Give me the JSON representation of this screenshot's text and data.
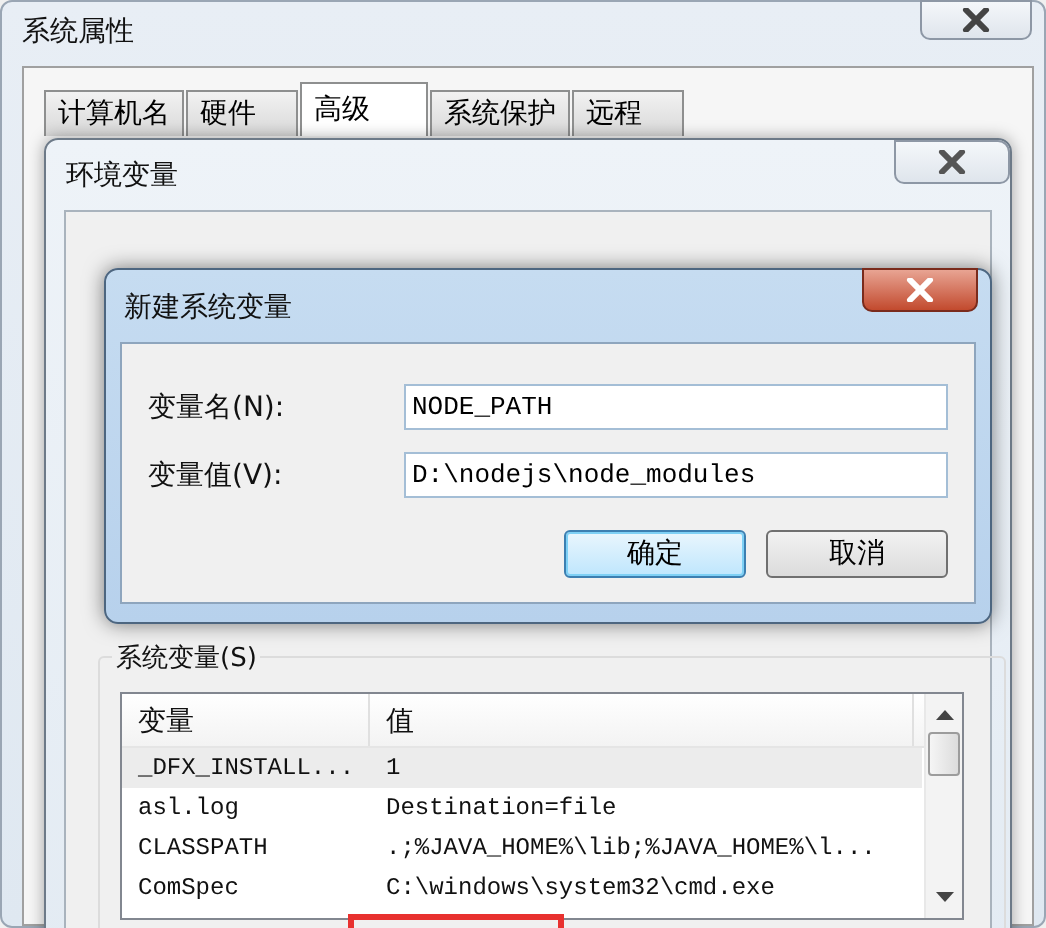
{
  "system_properties": {
    "title": "系统属性",
    "tabs": [
      {
        "label": "计算机名",
        "selected": false
      },
      {
        "label": "硬件",
        "selected": false
      },
      {
        "label": "高级",
        "selected": true
      },
      {
        "label": "系统保护",
        "selected": false
      },
      {
        "label": "远程",
        "selected": false
      }
    ]
  },
  "environment_variables": {
    "title": "环境变量"
  },
  "new_variable_dialog": {
    "title": "新建系统变量",
    "fields": [
      {
        "label": "变量名(N):",
        "value": "NODE_PATH"
      },
      {
        "label": "变量值(V):",
        "value": "D:\\nodejs\\node_modules"
      }
    ],
    "buttons": [
      {
        "label": "确定",
        "default": true
      },
      {
        "label": "取消",
        "default": false
      }
    ]
  },
  "system_variables": {
    "label": "系统变量(S)",
    "columns": [
      "变量",
      "值"
    ],
    "rows": [
      {
        "cells": [
          "_DFX_INSTALL...",
          "1"
        ],
        "selected": true
      },
      {
        "cells": [
          "asl.log",
          "Destination=file"
        ],
        "selected": false
      },
      {
        "cells": [
          "CLASSPATH",
          ".;%JAVA_HOME%\\lib;%JAVA_HOME%\\l..."
        ],
        "selected": false
      },
      {
        "cells": [
          "ComSpec",
          "C:\\windows\\system32\\cmd.exe"
        ],
        "selected": false
      }
    ]
  }
}
